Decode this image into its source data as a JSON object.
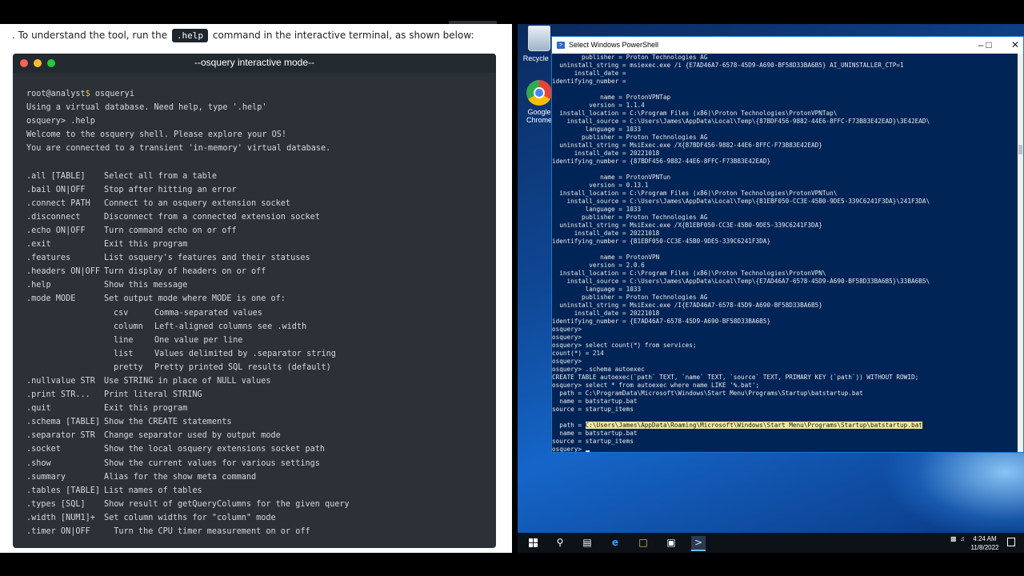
{
  "page": {
    "intro_before": ". To understand the tool, run the ",
    "intro_code": ".help",
    "intro_after": " command in the interactive terminal, as shown below:"
  },
  "terminal": {
    "title": "--osquery interactive mode--",
    "prompt_user": "root@analyst",
    "prompt_dollar": "$",
    "prompt_cmd": " osqueryi",
    "lines": [
      "Using a virtual database. Need help, type '.help'",
      "osquery> .help",
      "Welcome to the osquery shell. Please explore your OS!",
      "You are connected to a transient 'in-memory' virtual database."
    ],
    "commands": [
      {
        "cmd": ".all [TABLE]",
        "desc": "Select all from a table"
      },
      {
        "cmd": ".bail ON|OFF",
        "desc": "Stop after hitting an error"
      },
      {
        "cmd": ".connect PATH",
        "desc": "Connect to an osquery extension socket"
      },
      {
        "cmd": ".disconnect",
        "desc": "Disconnect from a connected extension socket"
      },
      {
        "cmd": ".echo ON|OFF",
        "desc": "Turn command echo on or off"
      },
      {
        "cmd": ".exit",
        "desc": "Exit this program"
      },
      {
        "cmd": ".features",
        "desc": "List osquery's features and their statuses"
      },
      {
        "cmd": ".headers ON|OFF",
        "desc": "Turn display of headers on or off"
      },
      {
        "cmd": ".help",
        "desc": "Show this message"
      },
      {
        "cmd": ".mode MODE",
        "desc": "Set output mode where MODE is one of:"
      }
    ],
    "modes": [
      {
        "mode": "csv",
        "desc": "Comma-separated values"
      },
      {
        "mode": "column",
        "desc": "Left-aligned columns see .width"
      },
      {
        "mode": "line",
        "desc": "One value per line"
      },
      {
        "mode": "list",
        "desc": "Values delimited by .separator string"
      },
      {
        "mode": "pretty",
        "desc": "Pretty printed SQL results (default)"
      }
    ],
    "commands2": [
      {
        "cmd": ".nullvalue STR",
        "desc": "Use STRING in place of NULL values"
      },
      {
        "cmd": ".print STR...",
        "desc": "Print literal STRING"
      },
      {
        "cmd": ".quit",
        "desc": "Exit this program"
      },
      {
        "cmd": ".schema [TABLE]",
        "desc": "Show the CREATE statements"
      },
      {
        "cmd": ".separator STR",
        "desc": "Change separator used by output mode"
      },
      {
        "cmd": ".socket",
        "desc": "Show the local osquery extensions socket path"
      },
      {
        "cmd": ".show",
        "desc": "Show the current values for various settings"
      },
      {
        "cmd": ".summary",
        "desc": "Alias for the show meta command"
      },
      {
        "cmd": ".tables [TABLE]",
        "desc": "List names of tables"
      },
      {
        "cmd": ".types [SQL]",
        "desc": "Show result of getQueryColumns for the given query"
      },
      {
        "cmd": ".width [NUM1]+",
        "desc": "Set column widths for \"column\" mode"
      },
      {
        "cmd": ".timer ON|OFF",
        "desc": "  Turn the CPU timer measurement on or off"
      }
    ]
  },
  "desktop": {
    "recycle_label": "Recycle B",
    "chrome_label_1": "Google",
    "chrome_label_2": "Chrome"
  },
  "powershell": {
    "title": "Select Windows PowerShell",
    "lines": [
      "        publisher = Proton Technologies AG",
      "  uninstall_string = msiexec.exe /i {E7AD46A7-6578-45D9-A690-BF58D33BA6B5} AI_UNINSTALLER_CTP=1",
      "      install_date = ",
      "identifying_number = ",
      "",
      "             name = ProtonVPNTap",
      "          version = 1.1.4",
      "  install_location = C:\\Program Files (x86)\\Proton Technologies\\ProtonVPNTap\\",
      "    install_source = C:\\Users\\James\\AppData\\Local\\Temp\\{87BDF456-9882-44E6-8FFC-F73B83E42EAD}\\3E42EAD\\",
      "         language = 1033",
      "        publisher = Proton Technologies AG",
      "  uninstall_string = MsiExec.exe /X{87BDF456-9882-44E6-8FFC-F73B83E42EAD}",
      "      install_date = 20221018",
      "identifying_number = {87BDF456-9882-44E6-8FFC-F73B83E42EAD}",
      "",
      "             name = ProtonVPNTun",
      "          version = 0.13.1",
      "  install_location = C:\\Program Files (x86)\\Proton Technologies\\ProtonVPNTun\\",
      "    install_source = C:\\Users\\James\\AppData\\Local\\Temp\\{B1EBF050-CC3E-45B0-9DE5-339C6241F3DA}\\241F3DA\\",
      "         language = 1033",
      "        publisher = Proton Technologies AG",
      "  uninstall_string = MsiExec.exe /X{B1EBF050-CC3E-45B0-9DE5-339C6241F3DA}",
      "      install_date = 20221018",
      "identifying_number = {B1EBF050-CC3E-45B0-9DE5-339C6241F3DA}",
      "",
      "             name = ProtonVPN",
      "          version = 2.0.6",
      "  install_location = C:\\Program Files (x86)\\Proton Technologies\\ProtonVPN\\",
      "    install_source = C:\\Users\\James\\AppData\\Local\\Temp\\{E7AD46A7-6578-45D9-A690-BF58D33BA6B5}\\33BA6B5\\",
      "         language = 1033",
      "        publisher = Proton Technologies AG",
      "  uninstall_string = MsiExec.exe /I{E7AD46A7-6578-45D9-A690-BF58D33BA6B5}",
      "      install_date = 20221018",
      "identifying_number = {E7AD46A7-6578-45D9-A690-BF58D33BA6B5}",
      "osquery>",
      "osquery>",
      "osquery> select count(*) from services;",
      "count(*) = 214",
      "osquery>",
      "osquery> .schema autoexec",
      "CREATE TABLE autoexec(`path` TEXT, `name` TEXT, `source` TEXT, PRIMARY KEY (`path`)) WITHOUT ROWID;",
      "osquery> select * from autoexec where name LIKE '%.bat';",
      "  path = C:\\ProgramData\\Microsoft\\Windows\\Start Menu\\Programs\\Startup\\batstartup.bat",
      "  name = batstartup.bat",
      "source = startup_items",
      ""
    ],
    "hl_prefix": "  path = ",
    "hl_path": "C:\\Users\\James\\AppData\\Roaming\\Microsoft\\Windows\\Start Menu\\Programs\\Startup\\batstartup.bat",
    "tail_lines": [
      "  name = batstartup.bat",
      "source = startup_items"
    ],
    "last_prompt": "osquery> "
  },
  "taskbar": {
    "time": "4:24 AM",
    "date": "11/8/2022"
  }
}
